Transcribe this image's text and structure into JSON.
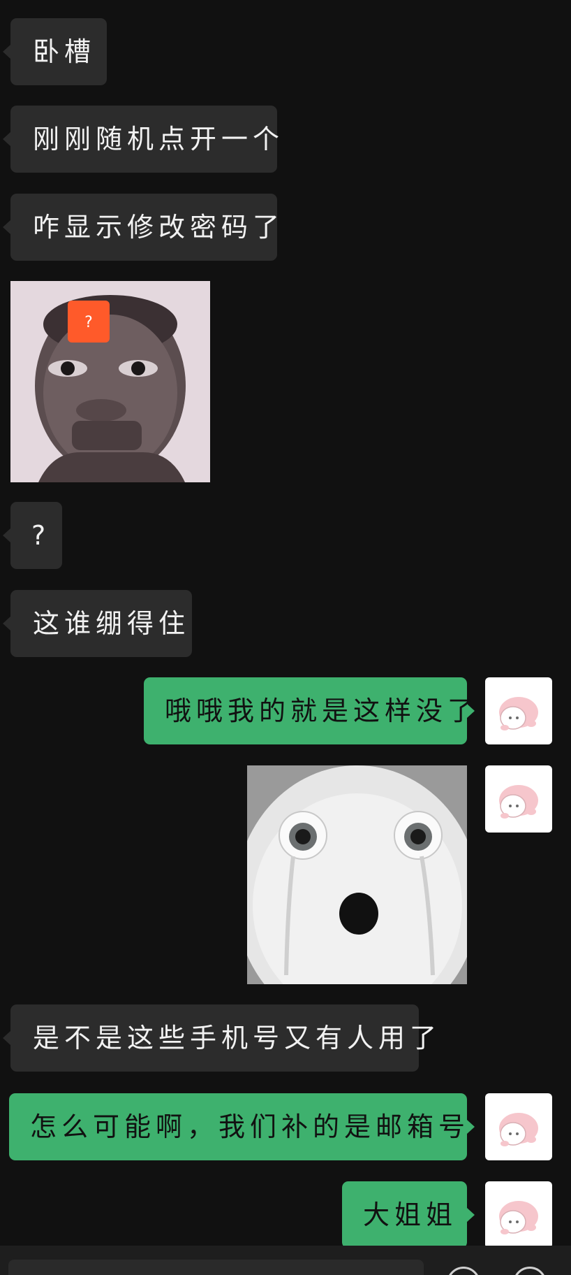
{
  "messages": [
    {
      "side": "in",
      "text": "卧槽"
    },
    {
      "side": "in",
      "text": "刚刚随机点开一个"
    },
    {
      "side": "in",
      "text": "咋显示修改密码了"
    },
    {
      "side": "in",
      "type": "image",
      "icon": "face-meme-with-question-mark-sticker"
    },
    {
      "side": "in",
      "text": "?"
    },
    {
      "side": "in",
      "text": "这谁绷得住"
    },
    {
      "side": "out",
      "text": "哦哦我的就是这样没了"
    },
    {
      "side": "out",
      "type": "image",
      "icon": "crying-white-blob-meme"
    },
    {
      "side": "in",
      "text": "是不是这些手机号又有人用了"
    },
    {
      "side": "out",
      "text": "怎么可能啊，我们补的是邮箱号."
    },
    {
      "side": "out",
      "text": "大姐姐"
    }
  ],
  "colors": {
    "background": "#111111",
    "incoming_bubble": "#2c2c2c",
    "outgoing_bubble": "#3eb16e",
    "incoming_text": "#f2f2f2",
    "outgoing_text": "#111111"
  },
  "question_badge": "?"
}
